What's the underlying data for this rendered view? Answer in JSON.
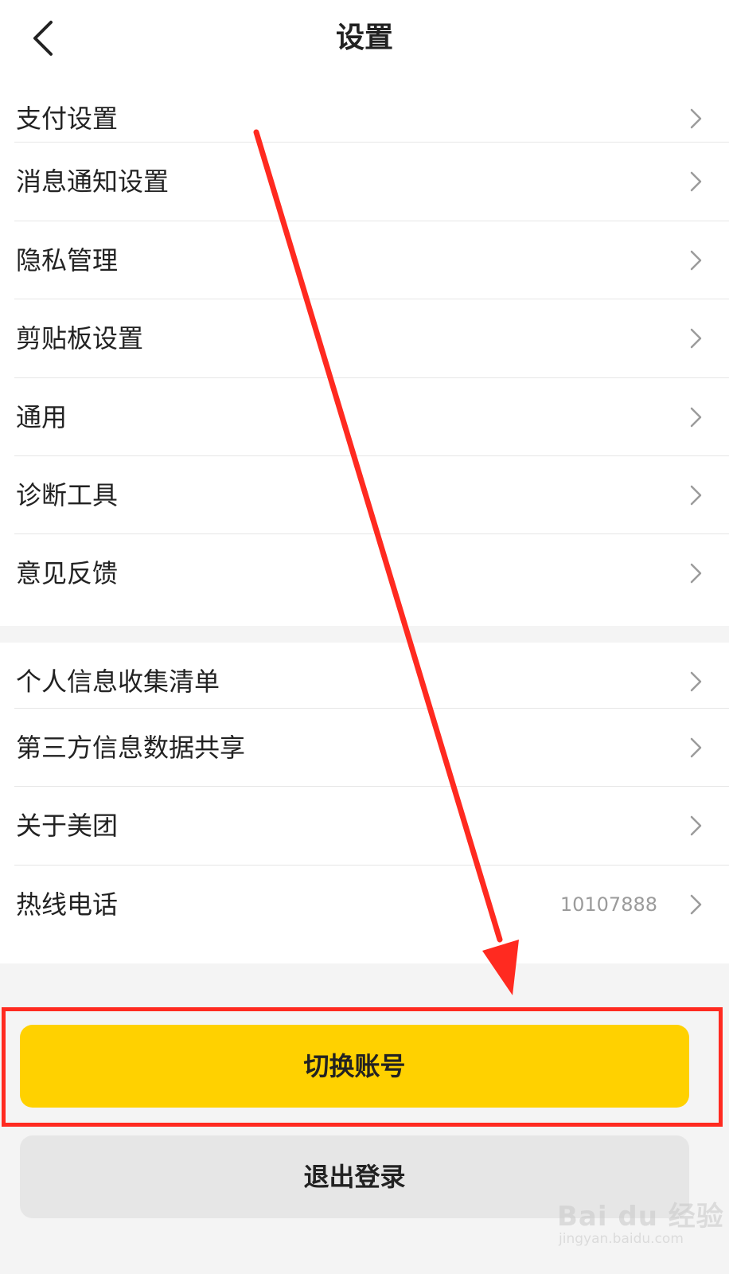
{
  "header": {
    "title": "设置",
    "back_icon": "chevron-left-icon"
  },
  "groups": [
    {
      "items": [
        {
          "label": "支付设置"
        },
        {
          "label": "消息通知设置"
        },
        {
          "label": "隐私管理"
        },
        {
          "label": "剪贴板设置"
        },
        {
          "label": "通用"
        },
        {
          "label": "诊断工具"
        },
        {
          "label": "意见反馈"
        }
      ]
    },
    {
      "items": [
        {
          "label": "个人信息收集清单"
        },
        {
          "label": "第三方信息数据共享"
        },
        {
          "label": "关于美团"
        },
        {
          "label": "热线电话",
          "value": "10107888"
        }
      ]
    }
  ],
  "row_icon": "chevron-right-icon",
  "buttons": {
    "switch_account": "切换账号",
    "logout": "退出登录"
  },
  "watermark": {
    "brand": "Bai du 经验",
    "url": "jingyan.baidu.com"
  },
  "colors": {
    "accent_yellow": "#ffd100",
    "annotation_red": "#ff2a20",
    "secondary_button": "#e6e6e6",
    "page_background": "#f4f4f4"
  }
}
